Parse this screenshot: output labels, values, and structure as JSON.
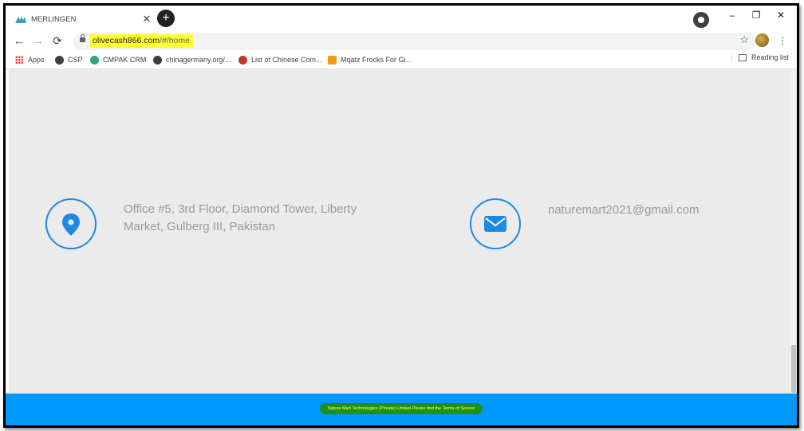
{
  "browser": {
    "tab_title": "MERLINGEN",
    "tab_close": "✕",
    "new_tab": "+",
    "url_host": "olivecash866.com",
    "url_path": "/#/home",
    "window": {
      "minimize": "–",
      "restore": "❐",
      "close": "✕"
    },
    "nav": {
      "back": "←",
      "forward": "→",
      "reload": "⟳"
    },
    "star": "☆",
    "menu": "⋮"
  },
  "bookmarks": {
    "items": [
      {
        "label": "Apps",
        "icon": "apps-grid-icon"
      },
      {
        "label": "CSP",
        "icon": "globe-icon"
      },
      {
        "label": "CMPAK CRM",
        "icon": "cmpak-icon"
      },
      {
        "label": "chinagermany.org/...",
        "icon": "globe-icon"
      },
      {
        "label": "List of Chinese Com...",
        "icon": "site-icon"
      },
      {
        "label": "Mqatz Frocks For Gi...",
        "icon": "site-icon"
      }
    ],
    "reading_list": "Reading list"
  },
  "contact": {
    "address": "Office #5, 3rd Floor, Diamond Tower, Liberty Market, Gulberg III, Pakistan",
    "email": "naturemart2021@gmail.com"
  },
  "footer": {
    "text": "Nature Mart Technologies (Private) Limited Please find the Terms of Service"
  },
  "colors": {
    "accent": "#1e88e5",
    "footer_bg": "#0099ff",
    "page_bg": "#ebebeb",
    "url_highlight": "#ffff33",
    "footer_highlight": "#1f8f1f"
  }
}
